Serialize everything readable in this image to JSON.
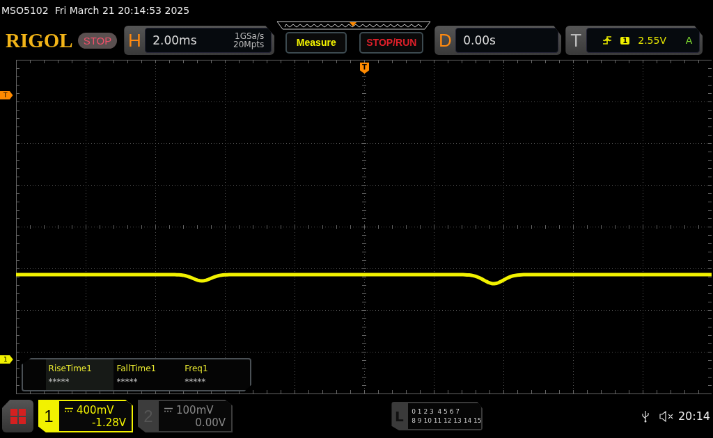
{
  "status_line": {
    "model": "MSO5102",
    "datetime": "Fri March 21 20:14:53 2025"
  },
  "logo": "RIGOL",
  "run_state": "STOP",
  "horizontal": {
    "label": "H",
    "scale": "2.00ms",
    "sample_rate": "1GSa/s",
    "memory_depth": "20Mpts"
  },
  "buttons": [
    {
      "label": "Measure",
      "kind": "measure"
    },
    {
      "label": "STOP/RUN",
      "kind": "run"
    }
  ],
  "delay": {
    "label": "D",
    "value": "0.00s"
  },
  "trigger": {
    "label": "T",
    "source": "1",
    "level": "2.55V",
    "mode": "A"
  },
  "markers": {
    "trigger_position": "T",
    "trigger_level": "T",
    "channel_1": "1"
  },
  "measurements": [
    {
      "name": "RiseTime1",
      "value": "*****",
      "selected": true
    },
    {
      "name": "FallTime1",
      "value": "*****",
      "selected": false
    },
    {
      "name": "Freq1",
      "value": "*****",
      "selected": false
    }
  ],
  "channels": [
    {
      "number": "1",
      "scale": "400mV",
      "offset": "-1.28V",
      "active": true
    },
    {
      "number": "2",
      "scale": "100mV",
      "offset": "0.00V",
      "active": false
    }
  ],
  "logic": {
    "label": "L",
    "rows": [
      "0 1 2 3  4 5 6 7",
      "8 9 10 11 12 13 14 15"
    ]
  },
  "status": {
    "time": "20:14"
  }
}
